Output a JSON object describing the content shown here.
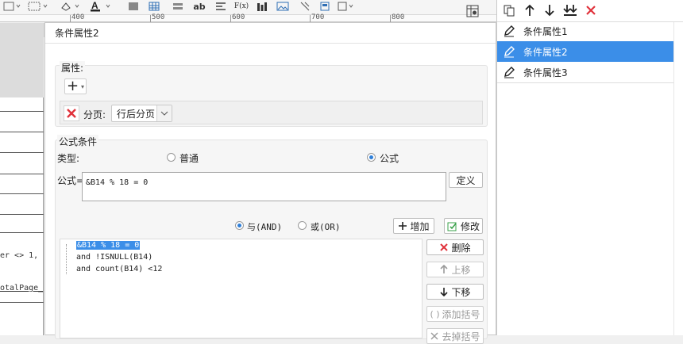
{
  "ruler": {
    "ticks": [
      "400",
      "500",
      "600",
      "700",
      "800"
    ]
  },
  "toolbar": {
    "text_icon": "ab",
    "fx_icon": "F(x)",
    "icons": [
      "table-icon",
      "grid-icon",
      "rows-icon",
      "text-ab-icon",
      "align-icon",
      "formula-icon",
      "bar-chart-icon",
      "image-icon",
      "slash-icon",
      "sheet-icon",
      "cell-icon"
    ]
  },
  "sheet": {
    "fragment1": "er <> 1, '",
    "fragment2": "otalPage_"
  },
  "dialog": {
    "title": "条件属性2",
    "property_section": {
      "label": "属性:",
      "add_symbol": "+",
      "pagination_label": "分页:",
      "pagination_value": "行后分页"
    },
    "formula_section": {
      "label": "公式条件",
      "type_label": "类型:",
      "type_options": [
        "普通",
        "公式"
      ],
      "type_selected": "公式",
      "formula_label": "公式=",
      "formula_value": "&B14 % 18 = 0",
      "define_button": "定义",
      "logic_options": [
        "与(AND)",
        "或(OR)"
      ],
      "logic_selected": "与(AND)",
      "add_button": "增加",
      "modify_button": "修改",
      "conditions": [
        "&B14 % 18 = 0",
        "and !ISNULL(B14)",
        "and count(B14) <12"
      ],
      "delete_button": "删除",
      "move_up_button": "上移",
      "move_down_button": "下移",
      "add_bracket_button": "添加括号",
      "remove_bracket_button": "去掉括号"
    }
  },
  "right_panel": {
    "items": [
      "条件属性1",
      "条件属性2",
      "条件属性3"
    ],
    "selected": "条件属性2"
  },
  "colors": {
    "selection": "#3b8ee8",
    "delete_red": "#e0323b",
    "formula_highlight": "#3b8ee8"
  }
}
